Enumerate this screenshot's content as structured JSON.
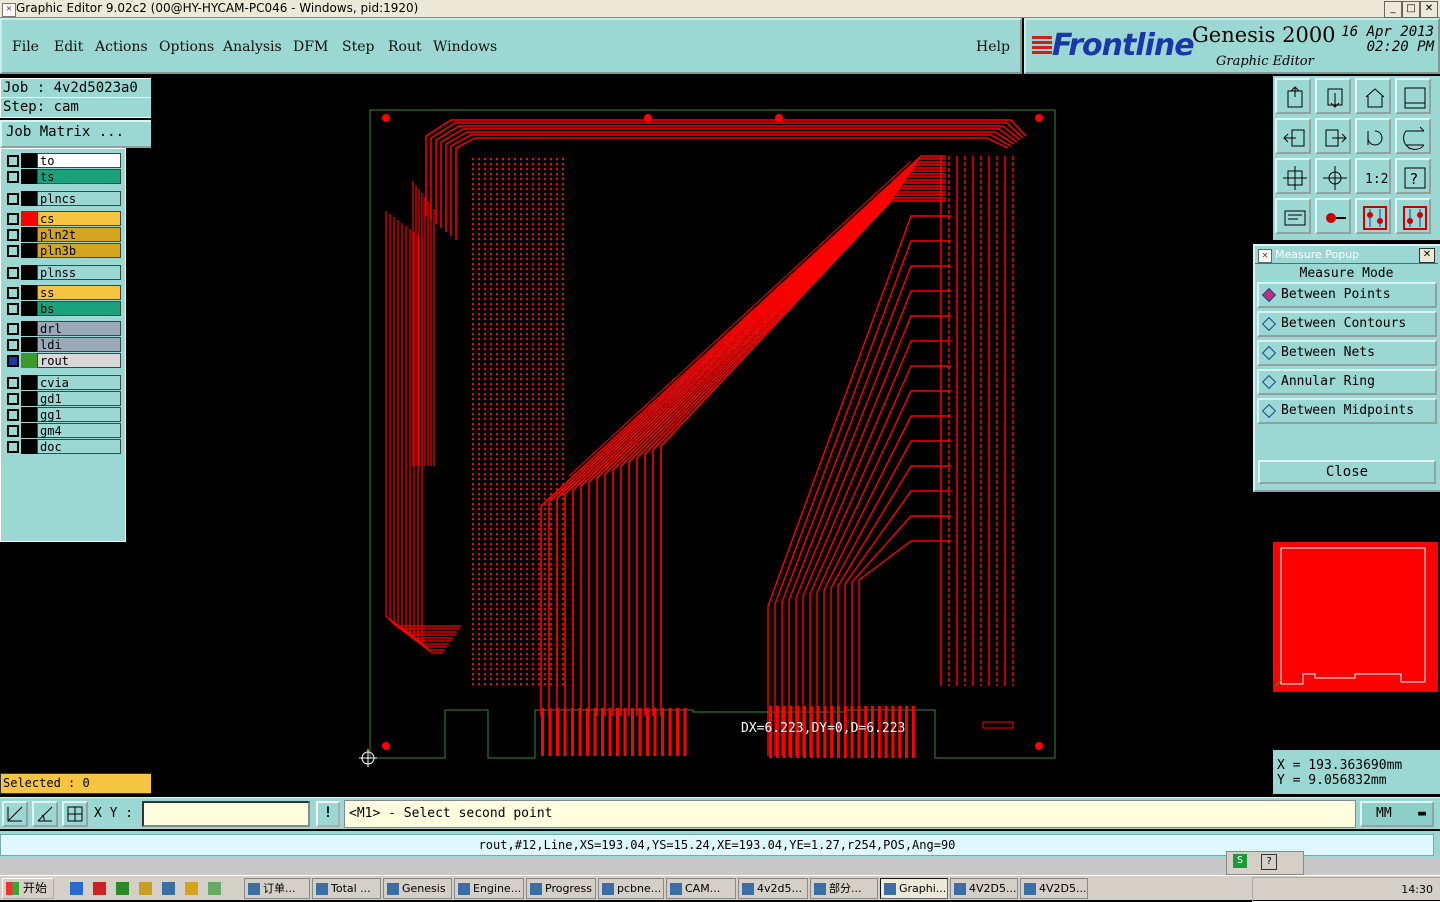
{
  "window": {
    "title": "Graphic Editor 9.02c2 (00@HY-HYCAM-PC046 - Windows, pid:1920)"
  },
  "menu": {
    "items": [
      "File",
      "Edit",
      "Actions",
      "Options",
      "Analysis",
      "DFM",
      "Step",
      "Rout",
      "Windows"
    ],
    "help": "Help"
  },
  "brand": {
    "logo": "Frontline",
    "product": "Genesis 2000",
    "subtitle": "Graphic Editor",
    "date": "16 Apr 2013",
    "time": "02:20 PM"
  },
  "job": {
    "job": "Job : 4v2d5023a0",
    "step": "Step: cam",
    "matrix_button": "Job Matrix ..."
  },
  "layers": [
    {
      "name": "to",
      "color": "#ffffff",
      "swatch": "#000000"
    },
    {
      "name": "ts",
      "color": "#1aa37a",
      "swatch": "#000000"
    },
    {
      "name": "plncs",
      "color": "#9bd7d3",
      "swatch": "#000000"
    },
    {
      "name": "cs",
      "color": "#f5c542",
      "swatch": "#ff0000"
    },
    {
      "name": "pln2t",
      "color": "#d4a520",
      "swatch": "#000000"
    },
    {
      "name": "pln3b",
      "color": "#d4a520",
      "swatch": "#000000"
    },
    {
      "name": "plnss",
      "color": "#9bd7d3",
      "swatch": "#000000"
    },
    {
      "name": "ss",
      "color": "#f5c542",
      "swatch": "#000000"
    },
    {
      "name": "bs",
      "color": "#1aa37a",
      "swatch": "#000000"
    },
    {
      "name": "drl",
      "color": "#9aaab8",
      "swatch": "#000000"
    },
    {
      "name": "ldi",
      "color": "#9aaab8",
      "swatch": "#000000"
    },
    {
      "name": "rout",
      "color": "#d8d8d8",
      "swatch": "#3a9a2a"
    },
    {
      "name": "cvia",
      "color": "#9bd7d3",
      "swatch": "#000000"
    },
    {
      "name": "gd1",
      "color": "#9bd7d3",
      "swatch": "#000000"
    },
    {
      "name": "gg1",
      "color": "#9bd7d3",
      "swatch": "#000000"
    },
    {
      "name": "gm4",
      "color": "#9bd7d3",
      "swatch": "#000000"
    },
    {
      "name": "doc",
      "color": "#9bd7d3",
      "swatch": "#000000"
    }
  ],
  "selected": "Selected : 0",
  "canvas": {
    "measure_text": "DX=6.223,DY=0,D=6.223",
    "trace_color": "#ff0000",
    "outline_color": "#2e8b3a"
  },
  "measure_popup": {
    "title": "Measure Popup",
    "heading": "Measure Mode",
    "modes": [
      "Between Points",
      "Between Contours",
      "Between Nets",
      "Annular Ring",
      "Between Midpoints"
    ],
    "selected_mode": "Between Points",
    "close": "Close"
  },
  "coords": {
    "x": "X  = 193.363690mm",
    "y": "Y  = 9.056832mm"
  },
  "cmd": {
    "xy_label": "X Y :",
    "bang": "!",
    "prompt": "<M1> - Select second point",
    "units": "MM"
  },
  "status": "rout,#12,Line,XS=193.04,YS=15.24,XE=193.04,YE=1.27,r254,POS,Ang=90",
  "taskbar": {
    "start": "开始",
    "items": [
      "订单...",
      "Total ...",
      "Genesis",
      "Engine...",
      "Progress",
      "pcbne...",
      "CAM...",
      "4v2d5...",
      "部分...",
      "Graphi...",
      "4V2D5...",
      "4V2D5..."
    ],
    "active": "Graphi...",
    "clock": "14:30"
  },
  "icons": [
    "import-icon",
    "export-icon",
    "home-icon",
    "layout-icon",
    "prev-icon",
    "next-icon",
    "undo-icon",
    "redo-icon",
    "fit-icon",
    "center-icon",
    "zoom-ratio-icon",
    "help-icon",
    "measure-icon",
    "key-icon",
    "snap-icon",
    "snap2-icon"
  ]
}
